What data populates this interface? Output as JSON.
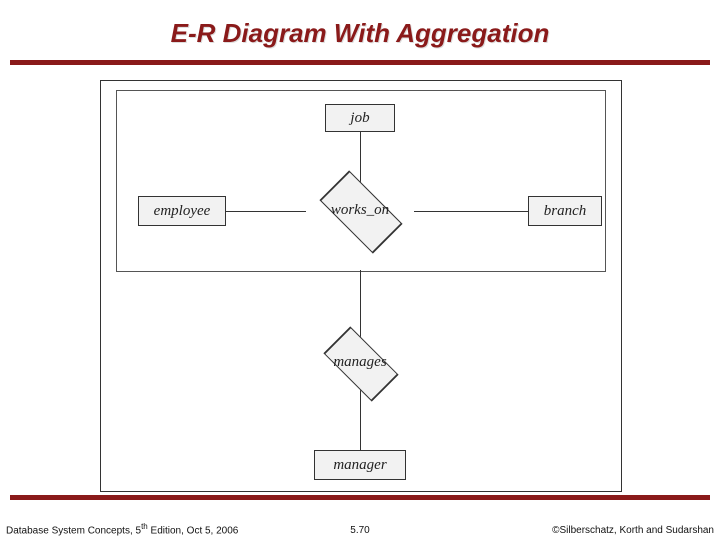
{
  "slide": {
    "title": "E-R Diagram With Aggregation",
    "footer_left_pre": "Database System Concepts, 5",
    "footer_left_sup": "th",
    "footer_left_post": " Edition, Oct 5, 2006",
    "footer_center": "5.70",
    "footer_right": "©Silberschatz, Korth and Sudarshan"
  },
  "diagram": {
    "entities": {
      "job": "job",
      "employee": "employee",
      "branch": "branch",
      "manager": "manager"
    },
    "relationships": {
      "works_on": "works_on",
      "manages": "manages"
    },
    "aggregation": {
      "contains": [
        "job",
        "employee",
        "works_on",
        "branch"
      ]
    },
    "edges": [
      [
        "job",
        "works_on"
      ],
      [
        "employee",
        "works_on"
      ],
      [
        "works_on",
        "branch"
      ],
      [
        "aggregation",
        "manages"
      ],
      [
        "manages",
        "manager"
      ]
    ]
  }
}
